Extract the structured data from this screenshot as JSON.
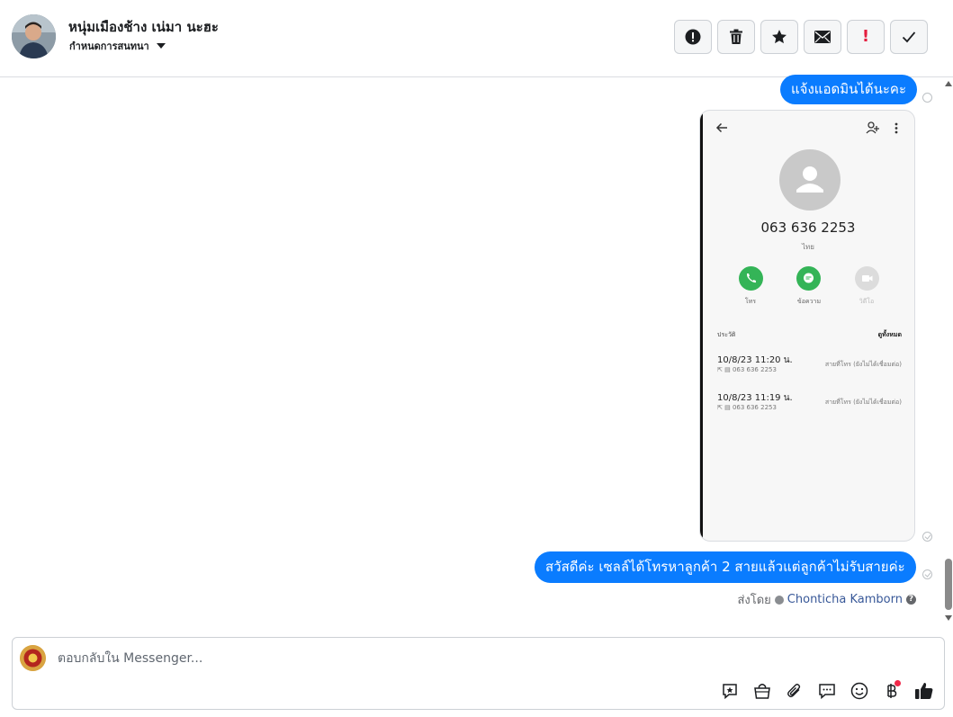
{
  "header": {
    "contact_name": "หนุ่มเมืองช้าง เน่มา นะฮะ",
    "subtitle": "กำหนดการสนทนา",
    "toolbar": [
      {
        "name": "alert-button",
        "icon": "exclamation-circle-icon"
      },
      {
        "name": "delete-button",
        "icon": "trash-icon"
      },
      {
        "name": "star-button",
        "icon": "star-icon"
      },
      {
        "name": "mark-unread-button",
        "icon": "envelope-icon"
      },
      {
        "name": "spam-button",
        "icon": "exclamation-icon",
        "label": "!"
      },
      {
        "name": "done-button",
        "icon": "check-icon"
      }
    ]
  },
  "conversation": {
    "messages": [
      {
        "type": "text",
        "text": "แจ้งแอดมินได้นะคะ"
      },
      {
        "type": "image"
      },
      {
        "type": "text",
        "text": "สวัสดีค่ะ เซลล์ได้โทรหาลูกค้า 2 สายแล้วแต่ลูกค้าไม่รับสายค่ะ"
      }
    ],
    "sent_by_label": "ส่งโดย",
    "sent_by_agent": "Chonticha Kamborn"
  },
  "phone_screenshot": {
    "number": "063 636 2253",
    "country": "ไทย",
    "actions": [
      {
        "label": "โทร",
        "color": "#34b457"
      },
      {
        "label": "ข้อความ",
        "color": "#34b457"
      },
      {
        "label": "วิดีโอ",
        "color": "#d8d8d8"
      }
    ],
    "history_title": "ประวัติ",
    "see_all": "ดูทั้งหมด",
    "calls": [
      {
        "time": "10/8/23 11:20 น.",
        "sub": "063 636 2253",
        "status": "สายที่โทร (ยังไม่ได้เชื่อมต่อ)"
      },
      {
        "time": "10/8/23 11:19 น.",
        "sub": "063 636 2253",
        "status": "สายที่โทร (ยังไม่ได้เชื่อมต่อ)"
      }
    ]
  },
  "composer": {
    "placeholder": "ตอบกลับใน Messenger...",
    "icons": [
      "saved-reply-icon",
      "shopping-bag-icon",
      "paperclip-icon",
      "chat-bubble-icon",
      "smiley-icon",
      "baht-icon",
      "thumbs-up-icon"
    ]
  },
  "colors": {
    "bubble": "#0a7cff",
    "accent_blue": "#385898",
    "alert_red": "#e41e3f"
  }
}
